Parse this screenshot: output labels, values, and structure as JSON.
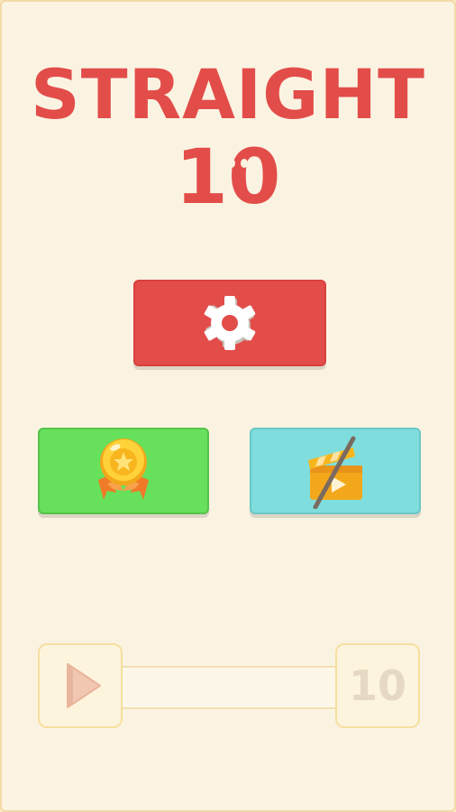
{
  "title": {
    "line1": "STRAIGHT",
    "line2": "10"
  },
  "buttons": {
    "settings_icon": "gear-icon",
    "achievements_icon": "medal-icon",
    "noads_icon": "no-video-ads-icon"
  },
  "progress": {
    "play_icon": "play-icon",
    "count": "10",
    "fill_fraction": 0
  },
  "colors": {
    "title": "#e24d4a",
    "settings": "#e24d4a",
    "achievements": "#67e05b",
    "noads": "#7fdedd",
    "background": "#fbf3e2"
  }
}
